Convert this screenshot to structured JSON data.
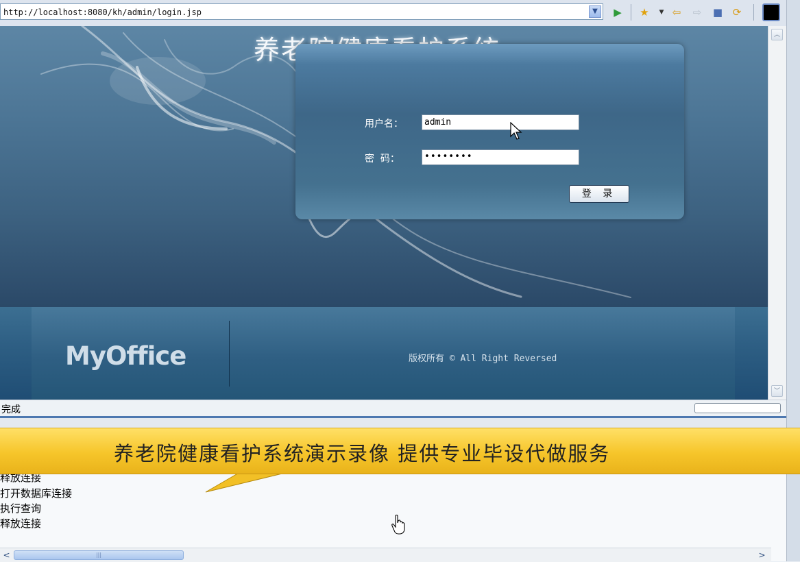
{
  "browser": {
    "url": "http://localhost:8080/kh/admin/login.jsp",
    "icons": [
      "go-arrow-icon",
      "favorites-star-icon",
      "back-arrow-icon",
      "forward-arrow-icon",
      "stop-icon",
      "refresh-icon"
    ]
  },
  "page": {
    "title": "养老院健康看护系统",
    "login": {
      "username_label": "用户名：",
      "username_value": "admin",
      "password_label": "密  码：",
      "password_value": "••••••••",
      "submit_label": "登 录"
    },
    "footer": {
      "logo": "MyOffice",
      "copyright": "版权所有 © All Right Reversed"
    }
  },
  "status_bar": {
    "text": "完成"
  },
  "console": {
    "lines": [
      "释放连接",
      "打开数据库连接",
      "执行查询",
      "释放连接"
    ]
  },
  "banner": {
    "text": "养老院健康看护系统演示录像 提供专业毕设代做服务"
  },
  "colors": {
    "page_bg": "#3d6281",
    "banner_bg": "#f6c52a",
    "accent": "#4d78b0"
  }
}
